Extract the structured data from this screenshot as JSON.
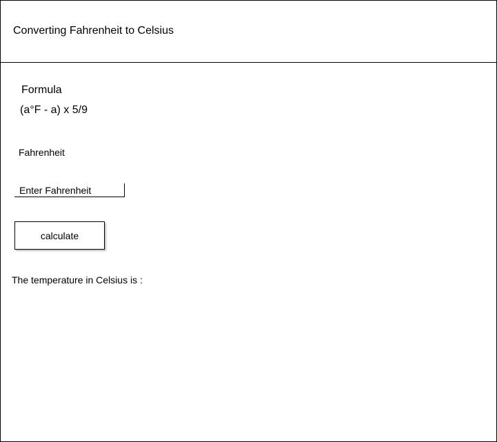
{
  "header": {
    "title": "Converting Fahrenheit to Celsius"
  },
  "formula": {
    "label": "Formula",
    "text": "(a°F - a) x 5/9"
  },
  "input": {
    "label": "Fahrenheit",
    "placeholder": "Enter Fahrenheit",
    "value": ""
  },
  "actions": {
    "calculate_label": "calculate"
  },
  "result": {
    "label": "The temperature in Celsius is :"
  }
}
